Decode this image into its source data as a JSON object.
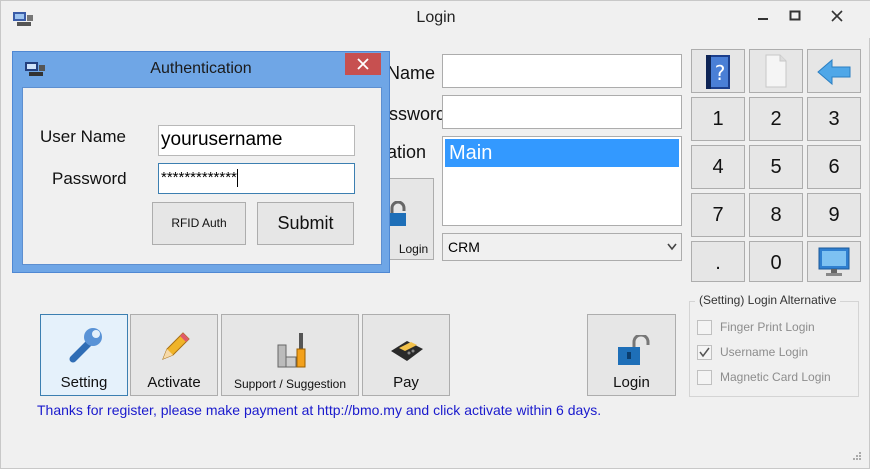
{
  "window": {
    "title": "Login",
    "minimize_icon": "minimize-icon",
    "maximize_icon": "maximize-icon",
    "close_icon": "close-icon"
  },
  "main_form": {
    "partial_labels": {
      "name": "Name",
      "password": "ssword",
      "location": "ation"
    },
    "location_items": [
      "Main"
    ],
    "module_select": {
      "value": "CRM"
    },
    "hidden_login_label": "Login"
  },
  "auth_dialog": {
    "title": "Authentication",
    "username_label": "User Name",
    "username_value": "yourusername",
    "password_label": "Password",
    "password_value": "*************",
    "rfid_label": "RFID Auth",
    "submit_label": "Submit"
  },
  "toolbar": {
    "setting_label": "Setting",
    "activate_label": "Activate",
    "support_label": "Support / Suggestion",
    "pay_label": "Pay",
    "login_label": "Login"
  },
  "keypad": {
    "keys": [
      "1",
      "2",
      "3",
      "4",
      "5",
      "6",
      "7",
      "8",
      "9",
      ".",
      "0"
    ]
  },
  "status_message": "Thanks for register, please make payment at http://bmo.my and click activate within 6 days.",
  "alternatives": {
    "title": "(Setting) Login Alternative",
    "options": [
      {
        "label": "Finger Print Login",
        "checked": false
      },
      {
        "label": "Username Login",
        "checked": true
      },
      {
        "label": "Magnetic Card Login",
        "checked": false
      }
    ]
  },
  "colors": {
    "accent": "#3399ff",
    "dialog_frame": "#6fa6e6",
    "close_red": "#c75050",
    "status_blue": "#1a1acd"
  }
}
